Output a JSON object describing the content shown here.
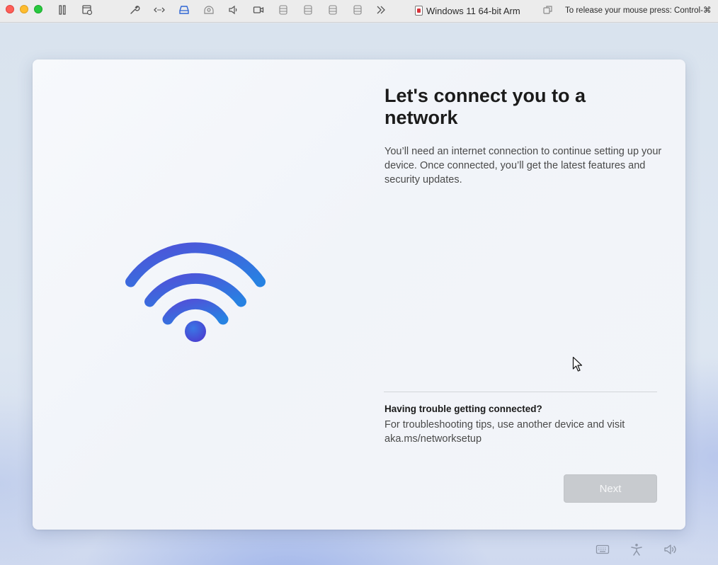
{
  "toolbar": {
    "window_title": "Windows 11 64-bit Arm",
    "release_hint": "To release your mouse press: Control-⌘",
    "icons": [
      "pause-icon",
      "snapshot-icon",
      "settings-wrench-icon",
      "network-icon",
      "disk-icon",
      "camera-share-icon",
      "sound-icon",
      "video-icon",
      "storage-icon",
      "storage-icon",
      "storage-icon",
      "storage-icon",
      "more-icon",
      "vm-badge-icon",
      "copy-window-icon"
    ]
  },
  "setup": {
    "heading": "Let's connect you to a network",
    "description": "You’ll need an internet connection to continue setting up your device. Once connected, you’ll get the latest features and security updates.",
    "trouble_title": "Having trouble getting connected?",
    "trouble_text": "For troubleshooting tips, use another device and visit aka.ms/networksetup",
    "next_label": "Next",
    "next_enabled": false
  },
  "tray": {
    "icons": [
      "keyboard-icon",
      "accessibility-icon",
      "volume-icon"
    ]
  },
  "colors": {
    "wifi_gradient_start": "#4a4fd8",
    "wifi_gradient_end": "#2a7de0",
    "button_disabled": "#c8cbcf"
  }
}
